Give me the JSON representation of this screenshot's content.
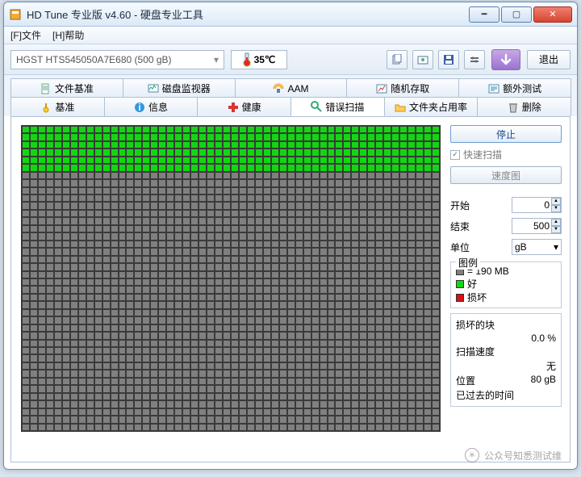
{
  "window": {
    "title": "HD Tune 专业版 v4.60 - 硬盘专业工具"
  },
  "menu": {
    "file": "[F]文件",
    "help": "[H]帮助"
  },
  "toolbar": {
    "drive": "HGST HTS545050A7E680 (500 gB)",
    "temp": "35℃",
    "exit": "退出"
  },
  "tabs_row1": [
    {
      "id": "file-baseline",
      "label": "文件基准"
    },
    {
      "id": "disk-monitor",
      "label": "磁盘监视器"
    },
    {
      "id": "aam",
      "label": "AAM"
    },
    {
      "id": "random-access",
      "label": "随机存取"
    },
    {
      "id": "extra-test",
      "label": "额外测试"
    }
  ],
  "tabs_row2": [
    {
      "id": "benchmark",
      "label": "基准"
    },
    {
      "id": "info",
      "label": "信息"
    },
    {
      "id": "health",
      "label": "健康"
    },
    {
      "id": "error-scan",
      "label": "错误扫描",
      "active": true
    },
    {
      "id": "folder-usage",
      "label": "文件夹占用率"
    },
    {
      "id": "delete",
      "label": "删除"
    }
  ],
  "scan": {
    "stop": "停止",
    "quick_scan": "快速扫描",
    "speed_map": "速度图",
    "start_label": "开始",
    "start_value": "0",
    "end_label": "结束",
    "end_value": "500",
    "unit_label": "单位",
    "unit_value": "gB",
    "legend_title": "图例",
    "legend_blocksize": "= 190 MB",
    "legend_good": "好",
    "legend_bad": "损坏",
    "stats": {
      "damaged_label": "损坏的块",
      "damaged_value": "0.0 %",
      "speed_label": "扫描速度",
      "speed_value": "无",
      "position_label": "位置",
      "position_value": "80 gB",
      "elapsed_label": "已过去的时间",
      "elapsed_value": ""
    }
  },
  "grid": {
    "cols": 52,
    "rows": 40,
    "green_rows": 6
  },
  "watermark": "公众号知悉测试维"
}
